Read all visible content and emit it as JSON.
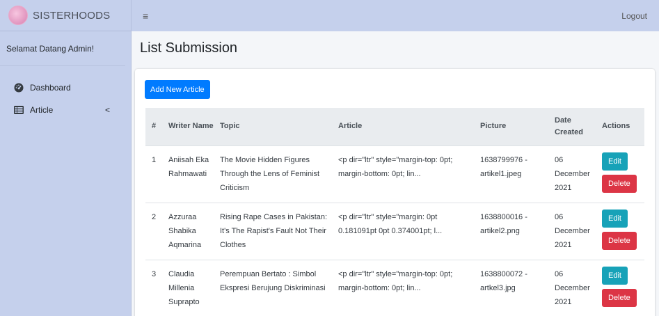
{
  "brand": {
    "name": "SISTERHOODS",
    "logo_text": "SISTER HOODS"
  },
  "sidebar": {
    "welcome": "Selamat Datang Admin!",
    "items": [
      {
        "label": "Dashboard",
        "icon": "tachometer-icon"
      },
      {
        "label": "Article",
        "icon": "list-icon",
        "chevron": "<"
      }
    ]
  },
  "topbar": {
    "menu_icon": "≡",
    "logout": "Logout"
  },
  "page": {
    "title": "List Submission"
  },
  "toolbar": {
    "add_label": "Add New Article"
  },
  "table": {
    "headers": {
      "num": "#",
      "writer": "Writer Name",
      "topic": "Topic",
      "article": "Article",
      "picture": "Picture",
      "date": "Date Created",
      "actions": "Actions"
    },
    "rows": [
      {
        "num": "1",
        "writer": "Aniisah Eka Rahmawati",
        "topic": "The Movie Hidden Figures Through the Lens of Feminist Criticism",
        "article": "<p dir=\"ltr\" style=\"margin-top: 0pt; margin-bottom: 0pt; lin...",
        "picture": "1638799976 - artikel1.jpeg",
        "date": "06 December 2021",
        "edit": "Edit",
        "delete": "Delete"
      },
      {
        "num": "2",
        "writer": "Azzuraa Shabika Aqmarina",
        "topic": "Rising Rape Cases in Pakistan: It's The Rapist's Fault Not Their Clothes",
        "article": "<p dir=\"ltr\" style=\"margin: 0pt 0.181091pt 0pt 0.374001pt; l...",
        "picture": "1638800016 - artikel2.png",
        "date": "06 December 2021",
        "edit": "Edit",
        "delete": "Delete"
      },
      {
        "num": "3",
        "writer": "Claudia Millenia Suprapto",
        "topic": "Perempuan Bertato : Simbol Ekspresi Berujung Diskriminasi",
        "article": "<p dir=\"ltr\" style=\"margin-top: 0pt; margin-bottom: 0pt; lin...",
        "picture": "1638800072 - artkel3.jpg",
        "date": "06 December 2021",
        "edit": "Edit",
        "delete": "Delete"
      }
    ]
  },
  "colors": {
    "sidebar_bg": "#c5d0ec",
    "primary": "#007bff",
    "info": "#17a2b8",
    "danger": "#dc3545"
  }
}
